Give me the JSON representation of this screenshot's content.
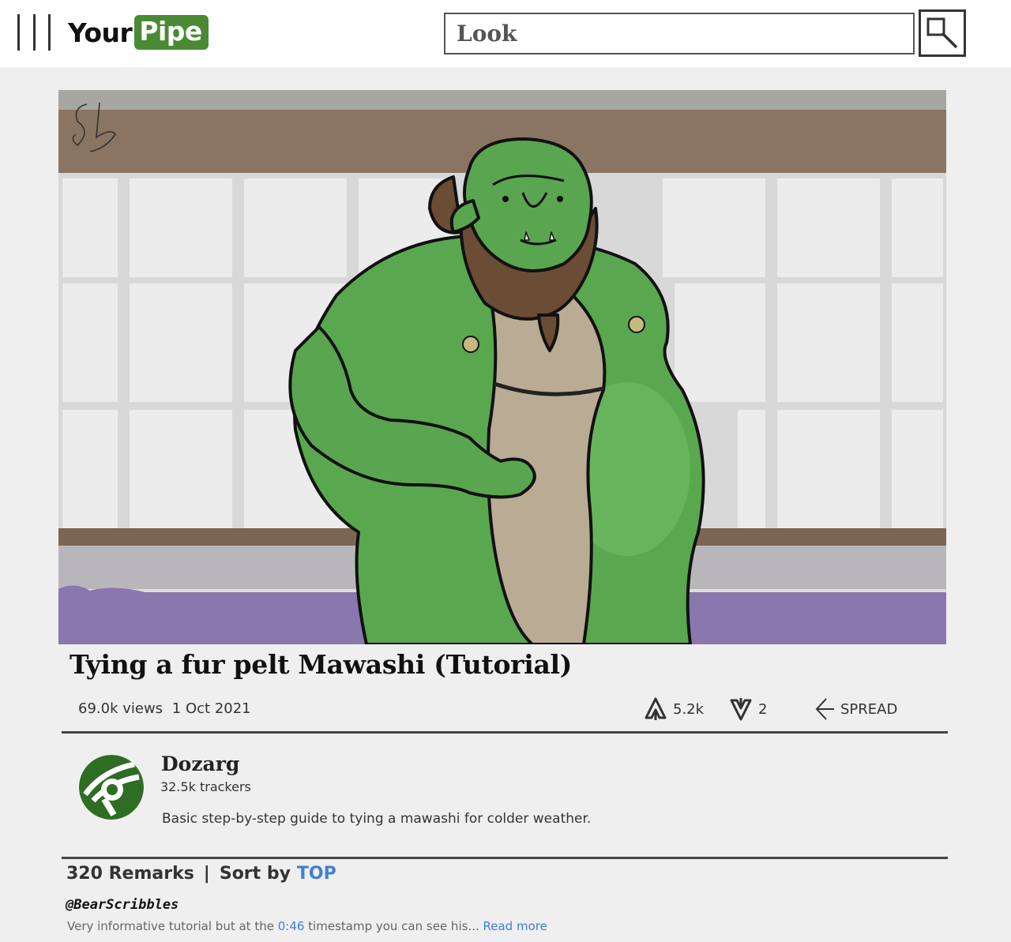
{
  "header": {
    "logo_part1": "Your",
    "logo_part2": "Pipe",
    "logo_color": "#4a8a35",
    "search_placeholder": "Look",
    "menu_icon": "hamburger-icon",
    "search_icon": "magnifier-icon"
  },
  "video": {
    "title": "Tying a fur pelt Mawashi (Tutorial)",
    "views": "69.0k views",
    "date": "1 Oct 2021",
    "likes": "5.2k",
    "dislikes": "2",
    "share_label": "SPREAD",
    "like_icon": "upvote-arrow-icon",
    "dislike_icon": "downvote-arrow-icon",
    "share_icon": "share-icon"
  },
  "channel": {
    "name": "Dozarg",
    "trackers": "32.5k trackers",
    "description": "Basic step-by-step guide to tying a mawashi for colder weather."
  },
  "comments": {
    "count_label": "320 Remarks",
    "separator": "|",
    "sort_label": "Sort by",
    "sort_value": "TOP",
    "accent_color": "#3d7fd6",
    "first": {
      "author": "@BearScribbles",
      "text_before": "Very informative tutorial but at the ",
      "timestamp": "0:46",
      "text_after": " timestamp you can see his...",
      "read_more": "Read more"
    }
  }
}
